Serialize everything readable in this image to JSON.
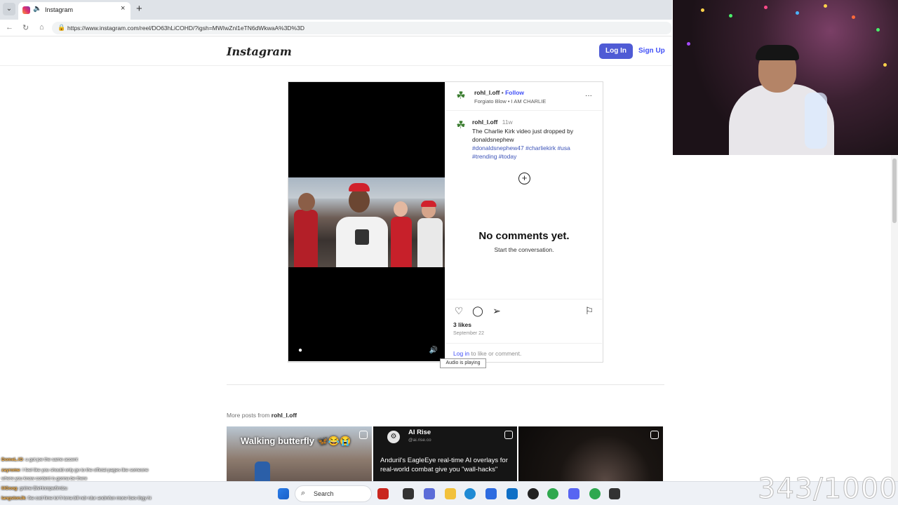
{
  "browser": {
    "tab_title": "Instagram",
    "new_tab": "+",
    "close": "×",
    "url": "https://www.instagram.com/reel/DO63hLiCOHD/?igsh=MWIwZnl1eTN6dWkwaA%3D%3D"
  },
  "header": {
    "logo": "Instagram",
    "login_label": "Log In",
    "signup_label": "Sign Up"
  },
  "post": {
    "author": "rohl_l.off",
    "follow_label": "Follow",
    "dot": "•",
    "audio_line": "Forgiato Blow • I AM CHARLIE",
    "more_label": "···",
    "caption_author": "rohl_l.off",
    "caption_time": "11w",
    "caption_text": "The Charlie Kirk video just dropped by donaldsnephew",
    "caption_tags": "#donaldsnephew47 #charliekirk #usa #trending #today",
    "no_comments": "No comments yet.",
    "start_conversation": "Start the conversation.",
    "likes": "3 likes",
    "date": "September 22",
    "login_link": "Log in",
    "login_rest": " to like or comment.",
    "audio_tooltip": "Audio is playing"
  },
  "more_posts": {
    "prefix": "More posts from ",
    "author": "rohl_l.off",
    "thumb1_title": "Walking butterfly 🦋😂😭",
    "thumb2_channel": "AI Rise",
    "thumb2_handle": "@ai.rise.co",
    "thumb2_text": "Anduril's EagleEye real-time AI overlays for real-world combat give you \"wall-hacks\""
  },
  "taskbar": {
    "search_label": "Search"
  },
  "overlay": {
    "counter": "343/1000",
    "chat": [
      {
        "user": "DomeL.lO",
        "text": ": u got joe the same accent"
      },
      {
        "user": "zayrome",
        "text": ": I feel like you should only go to the official pages like someone"
      },
      {
        "user": "",
        "text": "where you know content is gonna be there"
      },
      {
        "user": "lilGoog",
        "text": ": gnlme BlvHnmpwflrnlzu"
      },
      {
        "user": "langstonJk",
        "text": ": fke cod fime lol fi lcrra blll ndr rdur andmfun more fces thgy hi"
      }
    ]
  },
  "colors": {
    "login_button": "#4f5bd5",
    "link": "#4150f7",
    "hashtag": "#3d54b8"
  }
}
